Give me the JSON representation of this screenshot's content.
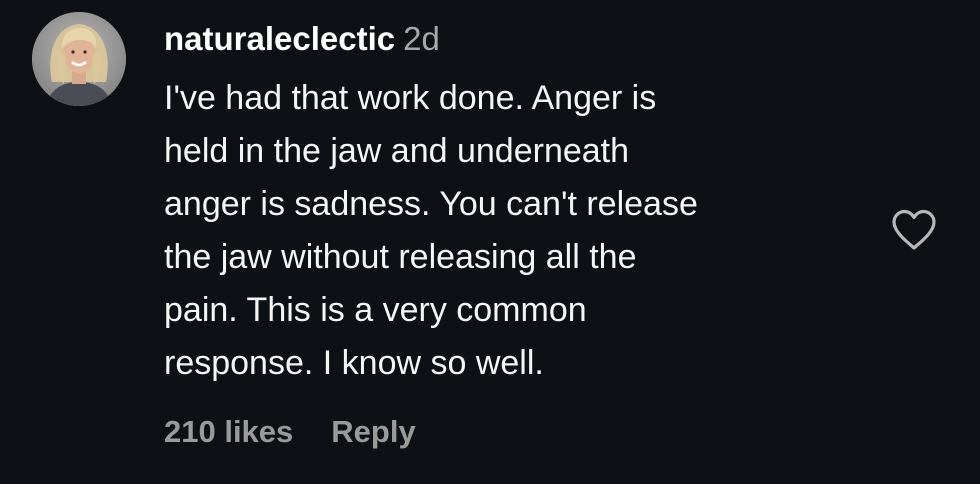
{
  "comment": {
    "username": "naturaleclectic",
    "time": "2d",
    "text_lines": [
      "I've had that work done. Anger is",
      "held in the jaw and underneath",
      "anger is sadness. You can't release",
      "the jaw without releasing all the",
      "pain. This is a very common",
      "response. I know so well."
    ],
    "likes": "210 likes",
    "reply_label": "Reply"
  },
  "colors": {
    "background": "#0d1115",
    "text": "#ffffff",
    "muted": "#a8a8a8"
  },
  "icons": {
    "like": "heart-outline-icon"
  }
}
